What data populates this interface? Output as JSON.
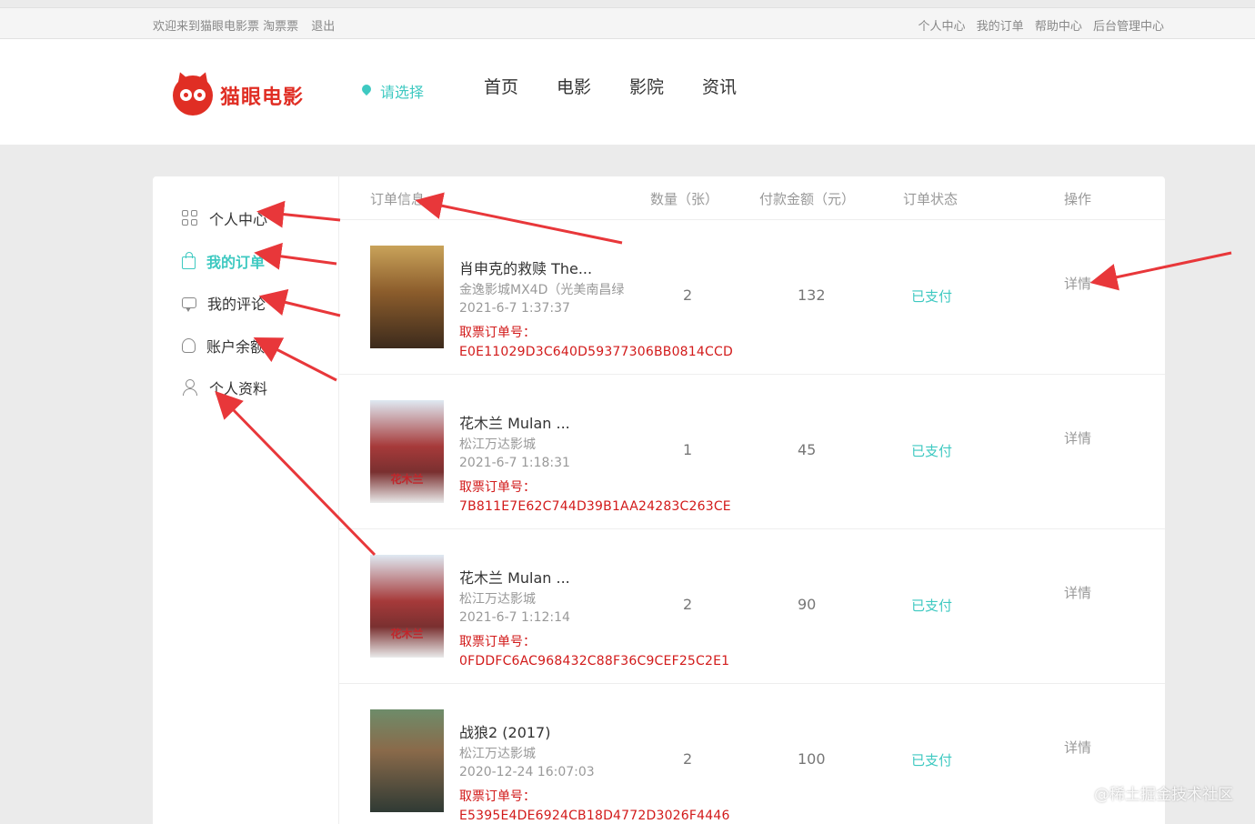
{
  "topbar": {
    "welcome": "欢迎来到猫眼电影票 淘票票",
    "logout": "退出",
    "links": [
      "个人中心",
      "我的订单",
      "帮助中心",
      "后台管理中心"
    ]
  },
  "header": {
    "logo_text": "猫眼电影",
    "city": "请选择",
    "nav": [
      "首页",
      "电影",
      "影院",
      "资讯"
    ]
  },
  "sidebar": {
    "items": [
      {
        "label": "个人中心",
        "icon": "grid-icon",
        "active": false
      },
      {
        "label": "我的订单",
        "icon": "bag-icon",
        "active": true
      },
      {
        "label": "我的评论",
        "icon": "comment-icon",
        "active": false
      },
      {
        "label": "账户余额",
        "icon": "wallet-icon",
        "active": false
      },
      {
        "label": "个人资料",
        "icon": "user-icon",
        "active": false
      }
    ]
  },
  "table": {
    "headers": [
      "订单信息",
      "数量（张）",
      "付款金额（元）",
      "订单状态",
      "操作"
    ],
    "rows": [
      {
        "title": "肖申克的救赎 The...",
        "cinema": "金逸影城MX4D（光美南昌绿",
        "time": "2021-6-7 1:37:37",
        "code_label": "取票订单号：",
        "code": "E0E11029D3C640D59377306BB0814CCD",
        "qty": "2",
        "amount": "132",
        "status": "已支付",
        "action": "详情"
      },
      {
        "title": "花木兰 Mulan ...",
        "cinema": "松江万达影城",
        "time": "2021-6-7 1:18:31",
        "code_label": "取票订单号：",
        "code": "7B811E7E62C744D39B1AA24283C263CE",
        "qty": "1",
        "amount": "45",
        "status": "已支付",
        "action": "详情"
      },
      {
        "title": "花木兰 Mulan ...",
        "cinema": "松江万达影城",
        "time": "2021-6-7 1:12:14",
        "code_label": "取票订单号：",
        "code": "0FDDFC6AC968432C88F36C9CEF25C2E1",
        "qty": "2",
        "amount": "90",
        "status": "已支付",
        "action": "详情"
      },
      {
        "title": "战狼2 (2017)",
        "cinema": "松江万达影城",
        "time": "2020-12-24 16:07:03",
        "code_label": "取票订单号：",
        "code": "E5395E4DE6924CB18D4772D3026F4446",
        "qty": "2",
        "amount": "100",
        "status": "已支付",
        "action": "详情"
      }
    ]
  },
  "posters": [
    "",
    "花木兰",
    "花木兰",
    ""
  ],
  "watermark": "@稀土掘金技术社区",
  "colors": {
    "accent": "#3ec9c1",
    "brand": "#e02e24",
    "code": "#d21a1a",
    "arrow": "#e8373a"
  }
}
